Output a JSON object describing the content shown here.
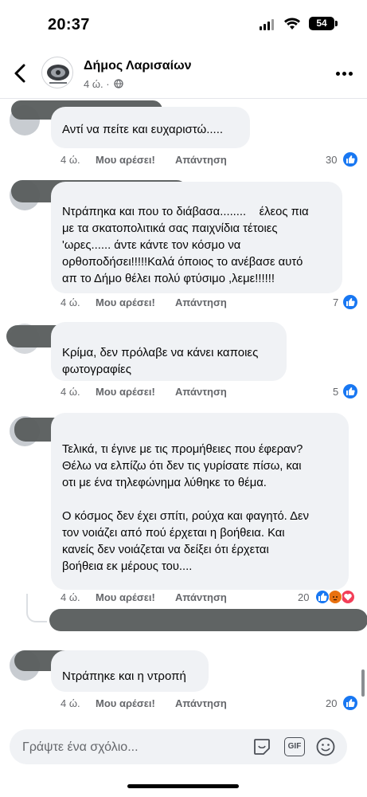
{
  "status_bar": {
    "time": "20:37",
    "battery": "54"
  },
  "header": {
    "page_name": "Δήμος Λαρισαίων",
    "meta": "4 ώ. ·"
  },
  "labels": {
    "like": "Μου αρέσει!",
    "reply": "Απάντηση"
  },
  "comments": [
    {
      "time": "4 ώ.",
      "text": "Αντί να πείτε και ευχαριστώ.....",
      "likes": "30"
    },
    {
      "time": "4 ώ.",
      "text": "Ντράπηκα και που το διάβασα........    έλεος πια\nμε τα σκατοπολιτικά σας παιχνίδια τέτοιες\n'ωρες...... άντε κάντε τον κόσμο να\nορθοποδήσει!!!!!Καλά όποιος το ανέβασε αυτό\nαπ το Δήμο θέλει πολύ φτύσιμο ,λεμε!!!!!!",
      "likes": "7"
    },
    {
      "time": "4 ώ.",
      "text": "Κρίμα, δεν πρόλαβε να κάνει καποιες\nφωτογραφίες",
      "likes": "5"
    },
    {
      "time": "4 ώ.",
      "text": "Τελικά, τι έγινε με τις προμήθειες που έφεραν?\nΘέλω να ελπίζω ότι δεν τις γυρίσατε πίσω, και\nοτι με ένα τηλεφώνημα λύθηκε το θέμα.\n\nΟ κόσμος δεν έχει σπίτι, ρούχα και φαγητό. Δεν\nτον νοιάζει από πού έρχεται η βοήθεια. Και\nκανείς δεν νοιάζεται να δείξει ότι έρχεται\nβοήθεια εκ μέρους του....",
      "likes": "20"
    },
    {
      "time": "4 ώ.",
      "text": "Ντράπηκε και η ντροπή",
      "likes": "20"
    }
  ],
  "composer": {
    "placeholder": "Γράψτε ένα σχόλιο...",
    "gif": "GIF"
  },
  "icons": [
    "back-arrow-icon",
    "globe-icon",
    "more-icon",
    "like-icon",
    "love-icon",
    "angry-icon",
    "sticker-icon",
    "gif-icon",
    "emoji-icon"
  ],
  "colors": {
    "like_blue": "#1877f2",
    "bubble": "#f0f2f5",
    "meta_gray": "#65676b",
    "love_red": "#f33e58",
    "angry_orange": "#e9710f"
  }
}
